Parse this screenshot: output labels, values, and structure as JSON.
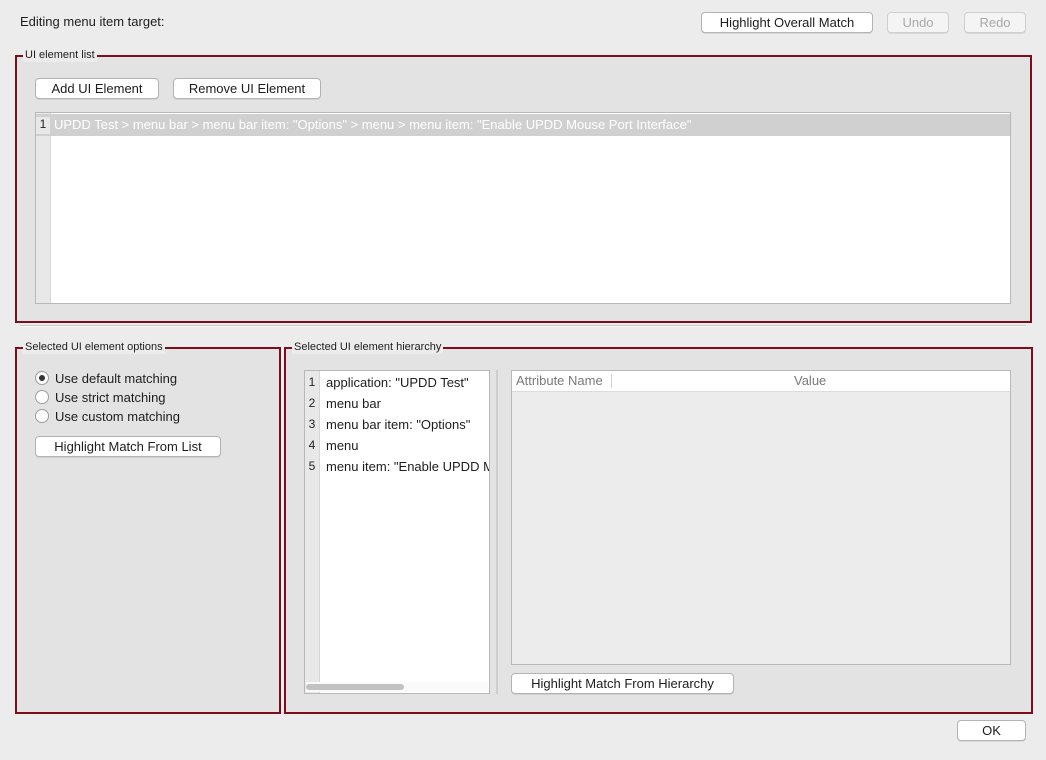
{
  "header": {
    "title": "Editing menu item target:",
    "highlight_overall_label": "Highlight Overall Match",
    "undo_label": "Undo",
    "redo_label": "Redo"
  },
  "ui_element_list": {
    "title": "UI element list",
    "add_label": "Add UI Element",
    "remove_label": "Remove UI Element",
    "rows": [
      {
        "num": "1",
        "text": "UPDD Test > menu bar > menu bar item: \"Options\" > menu > menu item: \"Enable UPDD Mouse Port Interface\""
      }
    ]
  },
  "options": {
    "title": "Selected UI element options",
    "radios": [
      {
        "label": "Use default matching",
        "selected": true
      },
      {
        "label": "Use strict matching",
        "selected": false
      },
      {
        "label": "Use custom matching",
        "selected": false
      }
    ],
    "highlight_label": "Highlight Match From List"
  },
  "hierarchy": {
    "title": "Selected UI element hierarchy",
    "rows": [
      {
        "num": "1",
        "text": "application: \"UPDD Test\""
      },
      {
        "num": "2",
        "text": "menu bar"
      },
      {
        "num": "3",
        "text": "menu bar item: \"Options\""
      },
      {
        "num": "4",
        "text": "menu"
      },
      {
        "num": "5",
        "text": "menu item: \"Enable UPDD Mouse Port Interface\""
      }
    ],
    "attr_col_name": "Attribute Name",
    "attr_col_value": "Value",
    "highlight_label": "Highlight Match From Hierarchy"
  },
  "footer": {
    "ok_label": "OK"
  },
  "colors": {
    "group_border": "#7a0e1c",
    "selected_row": "#d0d0d0"
  }
}
